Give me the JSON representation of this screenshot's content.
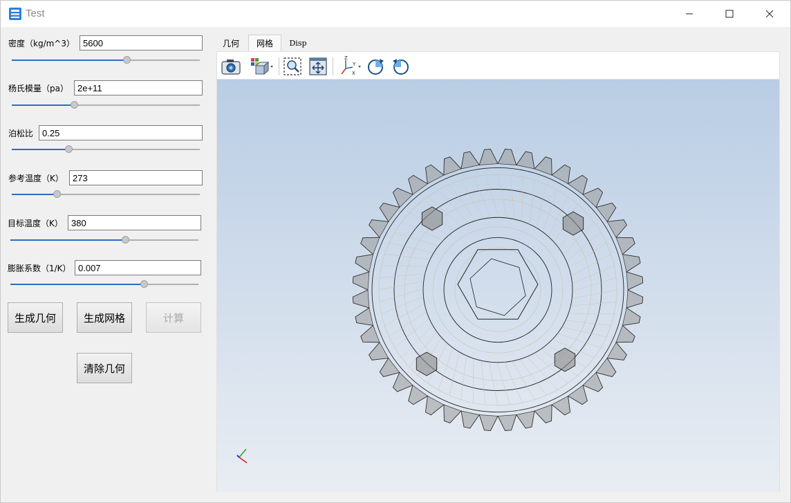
{
  "window": {
    "title": "Test"
  },
  "params": {
    "density": {
      "label": "密度（kg/m^3）",
      "value": "5600",
      "slider": 0.61
    },
    "youngs": {
      "label": "杨氏模量（pa）",
      "value": "2e+11",
      "slider": 0.33
    },
    "poisson": {
      "label": "泊松比",
      "value": "0.25",
      "slider": 0.3
    },
    "ref_temp": {
      "label": "参考温度（K）",
      "value": "273",
      "slider": 0.24
    },
    "target_temp": {
      "label": "目标温度（K）",
      "value": "380",
      "slider": 0.61
    },
    "expansion": {
      "label": "膨胀系数（1/K）",
      "value": "0.007",
      "slider": 0.71
    }
  },
  "buttons": {
    "gen_geometry": "生成几何",
    "gen_mesh": "生成网格",
    "compute": "计算",
    "clear_geometry": "清除几何"
  },
  "tabs": [
    {
      "label": "几何",
      "active": false
    },
    {
      "label": "网格",
      "active": true
    },
    {
      "label": "Disp",
      "active": false
    }
  ],
  "toolbar": {
    "icons": [
      "camera-icon",
      "view-cube-icon",
      "zoom-box-icon",
      "fit-all-icon",
      "axes-orientation-icon",
      "rotate-cw-icon",
      "rotate-ccw-icon"
    ]
  },
  "colors": {
    "accent": "#2b6cc4",
    "viewport_top": "#b9cde4",
    "viewport_bottom": "#e9edf3"
  }
}
